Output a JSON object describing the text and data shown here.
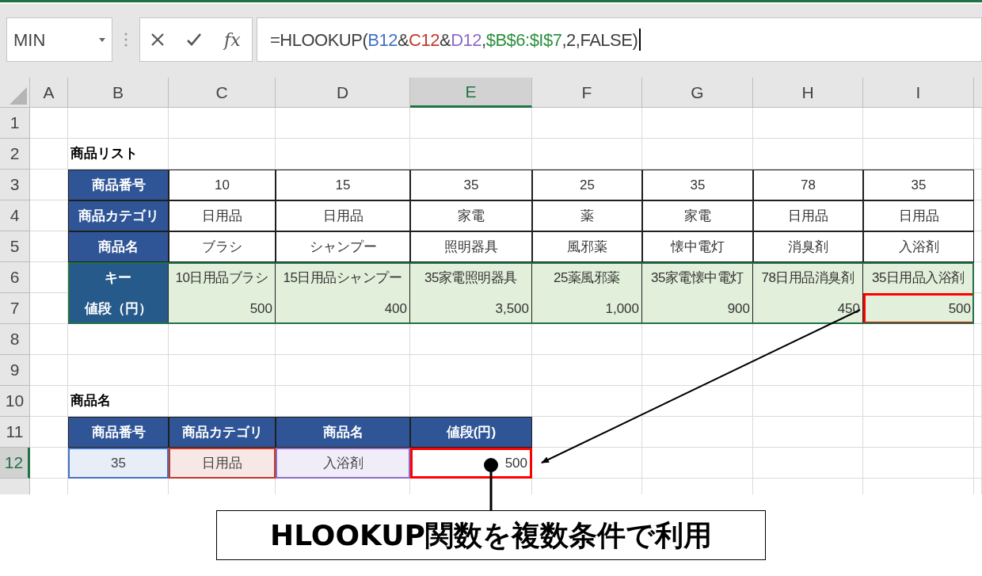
{
  "name_box": {
    "value": "MIN"
  },
  "formula_bar": {
    "function_button": "fx",
    "formula": [
      {
        "text": "=HLOOKUP(",
        "color": "#404040"
      },
      {
        "text": "B12",
        "color": "#4472c4"
      },
      {
        "text": "&",
        "color": "#404040"
      },
      {
        "text": "C12",
        "color": "#c0392b"
      },
      {
        "text": "&",
        "color": "#404040"
      },
      {
        "text": "D12",
        "color": "#8e6bc4"
      },
      {
        "text": ",",
        "color": "#404040"
      },
      {
        "text": "$B$6:$I$7",
        "color": "#2e9140"
      },
      {
        "text": ",2,FALSE)",
        "color": "#404040"
      }
    ]
  },
  "columns": [
    {
      "label": "A",
      "selected": false
    },
    {
      "label": "B",
      "selected": false
    },
    {
      "label": "C",
      "selected": false
    },
    {
      "label": "D",
      "selected": false
    },
    {
      "label": "E",
      "selected": true
    },
    {
      "label": "F",
      "selected": false
    },
    {
      "label": "G",
      "selected": false
    },
    {
      "label": "H",
      "selected": false
    },
    {
      "label": "I",
      "selected": false
    }
  ],
  "rows": [
    {
      "number": "1",
      "selected": false,
      "cells": []
    },
    {
      "number": "2",
      "selected": false,
      "cells": [
        {
          "text": "商品リスト",
          "kind": "title"
        }
      ]
    },
    {
      "number": "3",
      "selected": false,
      "cells": [
        {
          "text": "商品番号",
          "kind": "header"
        },
        {
          "text": "10",
          "kind": "value"
        },
        {
          "text": "15",
          "kind": "value"
        },
        {
          "text": "35",
          "kind": "value"
        },
        {
          "text": "25",
          "kind": "value"
        },
        {
          "text": "35",
          "kind": "value"
        },
        {
          "text": "78",
          "kind": "value"
        },
        {
          "text": "35",
          "kind": "value"
        }
      ]
    },
    {
      "number": "4",
      "selected": false,
      "cells": [
        {
          "text": "商品カテゴリ",
          "kind": "header"
        },
        {
          "text": "日用品",
          "kind": "value"
        },
        {
          "text": "日用品",
          "kind": "value"
        },
        {
          "text": "家電",
          "kind": "value"
        },
        {
          "text": "薬",
          "kind": "value"
        },
        {
          "text": "家電",
          "kind": "value"
        },
        {
          "text": "日用品",
          "kind": "value"
        },
        {
          "text": "日用品",
          "kind": "value"
        }
      ]
    },
    {
      "number": "5",
      "selected": false,
      "cells": [
        {
          "text": "商品名",
          "kind": "header"
        },
        {
          "text": "ブラシ",
          "kind": "value"
        },
        {
          "text": "シャンプー",
          "kind": "value"
        },
        {
          "text": "照明器具",
          "kind": "value"
        },
        {
          "text": "風邪薬",
          "kind": "value"
        },
        {
          "text": "懐中電灯",
          "kind": "value"
        },
        {
          "text": "消臭剤",
          "kind": "value"
        },
        {
          "text": "入浴剤",
          "kind": "value"
        }
      ]
    },
    {
      "number": "6",
      "selected": false,
      "cells": [
        {
          "text": "キー",
          "kind": "range_header"
        },
        {
          "text": "10日用品ブラシ",
          "kind": "key"
        },
        {
          "text": "15日用品シャンプー",
          "kind": "key"
        },
        {
          "text": "35家電照明器具",
          "kind": "key"
        },
        {
          "text": "25薬風邪薬",
          "kind": "key"
        },
        {
          "text": "35家電懐中電灯",
          "kind": "key"
        },
        {
          "text": "78日用品消臭剤",
          "kind": "key"
        },
        {
          "text": "35日用品入浴剤",
          "kind": "key"
        }
      ]
    },
    {
      "number": "7",
      "selected": false,
      "cells": [
        {
          "text": "値段（円）",
          "kind": "range_header"
        },
        {
          "text": "500",
          "kind": "price"
        },
        {
          "text": "400",
          "kind": "price"
        },
        {
          "text": "3,500",
          "kind": "price"
        },
        {
          "text": "1,000",
          "kind": "price"
        },
        {
          "text": "900",
          "kind": "price"
        },
        {
          "text": "450",
          "kind": "price"
        },
        {
          "text": "500",
          "kind": "price",
          "highlighted": true
        }
      ]
    },
    {
      "number": "8",
      "selected": false,
      "cells": []
    },
    {
      "number": "9",
      "selected": false,
      "cells": []
    },
    {
      "number": "10",
      "selected": false,
      "cells": [
        {
          "text": "商品名",
          "kind": "title"
        }
      ]
    },
    {
      "number": "11",
      "selected": false,
      "cells": [
        {
          "text": "商品番号",
          "kind": "header"
        },
        {
          "text": "商品カテゴリ",
          "kind": "header"
        },
        {
          "text": "商品名",
          "kind": "header"
        },
        {
          "text": "値段(円)",
          "kind": "header"
        }
      ]
    },
    {
      "number": "12",
      "selected": true,
      "cells": [
        {
          "text": "35",
          "kind": "ref",
          "color": "#4472c4"
        },
        {
          "text": "日用品",
          "kind": "ref",
          "color": "#c0392b"
        },
        {
          "text": "入浴剤",
          "kind": "ref",
          "color": "#8e6bc4"
        },
        {
          "text": "500",
          "kind": "result",
          "highlighted": true
        }
      ]
    }
  ],
  "callout": {
    "text": "HLOOKUP関数を複数条件で利用"
  }
}
